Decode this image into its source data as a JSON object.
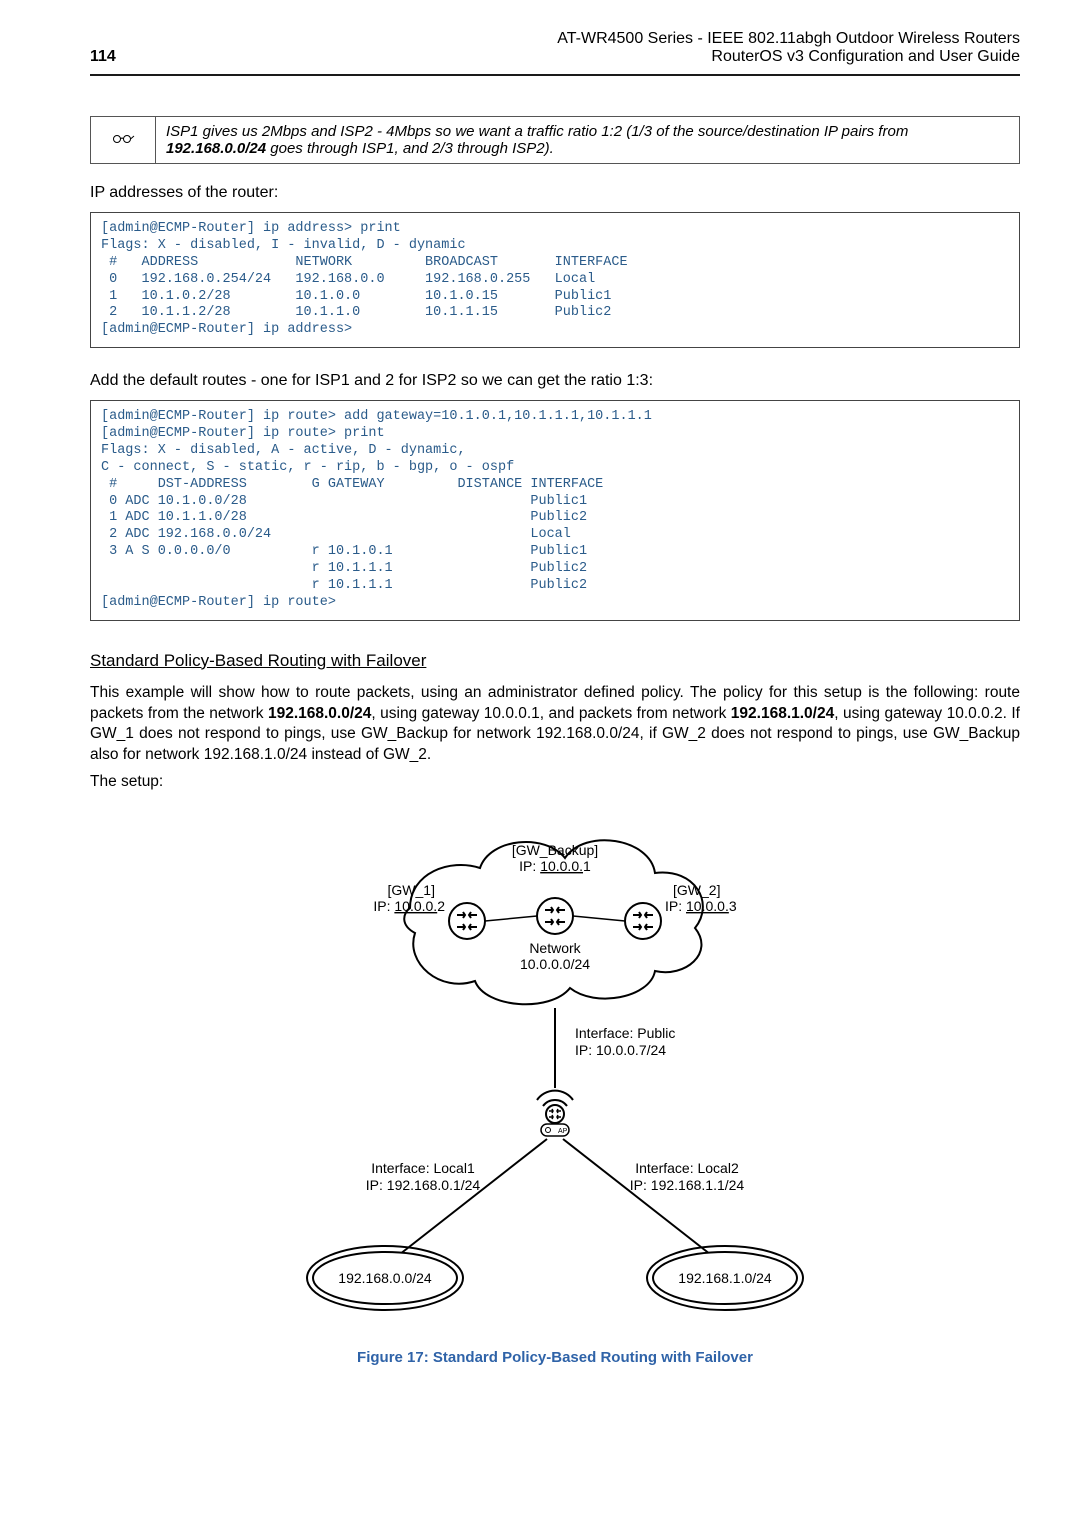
{
  "page_number": "114",
  "header_line1": "AT-WR4500 Series - IEEE 802.11abgh Outdoor Wireless Routers",
  "header_line2": "RouterOS v3 Configuration and User Guide",
  "note_text_1": "ISP1 gives us 2Mbps and ISP2 - 4Mbps so we want a traffic ratio 1:2 (1/3 of the source/destination IP pairs from ",
  "note_bold": "192.168.0.0/24",
  "note_text_2": " goes through ISP1, and 2/3 through ISP2).",
  "label_ip": "IP addresses of the router:",
  "code_ip": "[admin@ECMP-Router] ip address> print\nFlags: X - disabled, I - invalid, D - dynamic\n #   ADDRESS            NETWORK         BROADCAST       INTERFACE\n 0   192.168.0.254/24   192.168.0.0     192.168.0.255   Local\n 1   10.1.0.2/28        10.1.0.0        10.1.0.15       Public1\n 2   10.1.1.2/28        10.1.1.0        10.1.1.15       Public2\n[admin@ECMP-Router] ip address>",
  "label_routes": "Add the default routes - one for ISP1 and 2 for ISP2 so we can get the ratio 1:3:",
  "code_routes": "[admin@ECMP-Router] ip route> add gateway=10.1.0.1,10.1.1.1,10.1.1.1\n[admin@ECMP-Router] ip route> print\nFlags: X - disabled, A - active, D - dynamic,\nC - connect, S - static, r - rip, b - bgp, o - ospf\n #     DST-ADDRESS        G GATEWAY         DISTANCE INTERFACE\n 0 ADC 10.1.0.0/28                                   Public1\n 1 ADC 10.1.1.0/28                                   Public2\n 2 ADC 192.168.0.0/24                                Local\n 3 A S 0.0.0.0/0          r 10.1.0.1                 Public1\n                          r 10.1.1.1                 Public2\n                          r 10.1.1.1                 Public2\n[admin@ECMP-Router] ip route>",
  "section_heading": "Standard Policy-Based Routing with Failover",
  "para1_a": "This example will show how to route packets, using an administrator defined policy. The policy for this setup is the following: route packets from the network ",
  "para1_b1": "192.168.0.0/24",
  "para1_b": ", using gateway 10.0.0.1, and packets from network ",
  "para1_b2": "192.168.1.0/24",
  "para1_c": ", using gateway 10.0.0.2. If GW_1 does not respond to pings, use GW_Backup for network 192.168.0.0/24, if GW_2 does not respond to pings, use GW_Backup also for network 192.168.1.0/24 instead of GW_2.",
  "para2": "The setup:",
  "figure_caption": "Figure 17: Standard Policy-Based Routing with Failover",
  "diagram": {
    "gw_backup": "[GW_Backup]",
    "gw_backup_ip": "IP: 10.0.0.1",
    "gw1": "[GW_1]",
    "gw1_ip": "IP: 10.0.0.2",
    "gw2": "[GW_2]",
    "gw2_ip": "IP: 10.0.0.3",
    "network": "Network",
    "network_ip": "10.0.0.0/24",
    "iface_public": "Interface: Public",
    "iface_public_ip": "IP: 10.0.0.7/24",
    "iface_local1": "Interface: Local1",
    "iface_local1_ip": "IP: 192.168.0.1/24",
    "iface_local2": "Interface: Local2",
    "iface_local2_ip": "IP: 192.168.1.1/24",
    "net_left": "192.168.0.0/24",
    "net_right": "192.168.1.0/24"
  }
}
